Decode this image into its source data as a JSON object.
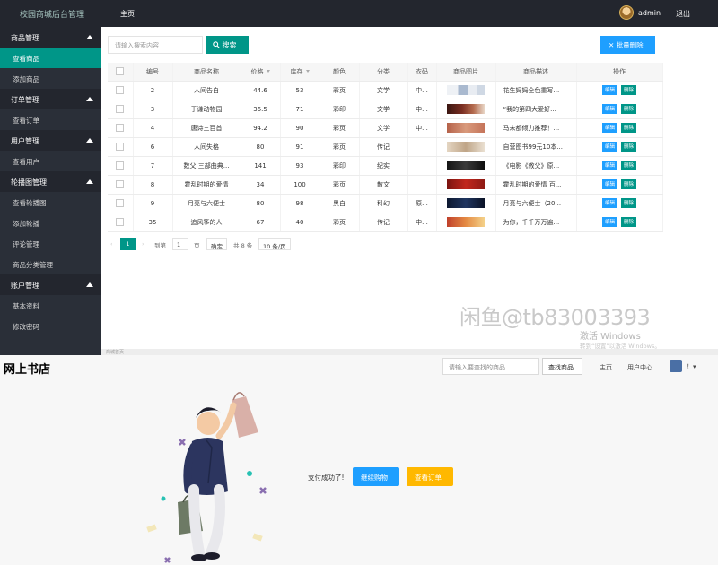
{
  "admin": {
    "brand": "校园商城后台管理",
    "top_home": "主页",
    "username": "admin",
    "logout": "退出",
    "sidebar": [
      {
        "type": "group",
        "label": "商品管理"
      },
      {
        "type": "item",
        "label": "查看商品",
        "active": true
      },
      {
        "type": "item",
        "label": "添加商品"
      },
      {
        "type": "group",
        "label": "订单管理"
      },
      {
        "type": "item",
        "label": "查看订单"
      },
      {
        "type": "group",
        "label": "用户管理"
      },
      {
        "type": "item",
        "label": "查看用户"
      },
      {
        "type": "group",
        "label": "轮播图管理"
      },
      {
        "type": "item",
        "label": "查看轮播图"
      },
      {
        "type": "item",
        "label": "添加轮播"
      },
      {
        "type": "item",
        "label": "评论管理"
      },
      {
        "type": "item",
        "label": "商品分类管理"
      },
      {
        "type": "group",
        "label": "账户管理"
      },
      {
        "type": "item",
        "label": "基本资料"
      },
      {
        "type": "item",
        "label": "修改密码"
      }
    ],
    "search": {
      "placeholder": "请输入搜索内容",
      "button": "搜索"
    },
    "batch_delete": "批量删除",
    "table": {
      "headers": [
        "编号",
        "商品名称",
        "价格",
        "库存",
        "颜色",
        "分类",
        "衣码",
        "商品图片",
        "商品描述",
        "操作"
      ],
      "rows": [
        {
          "id": "2",
          "name": "人间告白",
          "price": "44.6",
          "stock": "53",
          "color": "彩页",
          "category": "文学",
          "size": "中...",
          "desc": "花生妈妈全色重写..."
        },
        {
          "id": "3",
          "name": "于谦动物园",
          "price": "36.5",
          "stock": "71",
          "color": "彩印",
          "category": "文学",
          "size": "中...",
          "desc": "“我的第四大爱好..."
        },
        {
          "id": "4",
          "name": "唐诗三百首",
          "price": "94.2",
          "stock": "90",
          "color": "彩页",
          "category": "文学",
          "size": "中...",
          "desc": "马未都倾力推荐！..."
        },
        {
          "id": "6",
          "name": "人间失格",
          "price": "80",
          "stock": "91",
          "color": "彩页",
          "category": "传记",
          "size": "",
          "desc": "自营图书99元10本..."
        },
        {
          "id": "7",
          "name": "数父 三部曲典...",
          "price": "141",
          "stock": "93",
          "color": "彩印",
          "category": "纪实",
          "size": "",
          "desc": "《电影《教父》原..."
        },
        {
          "id": "8",
          "name": "霍乱时期的爱情",
          "price": "34",
          "stock": "100",
          "color": "彩页",
          "category": "散文",
          "size": "",
          "desc": "霍乱时期的爱情 百..."
        },
        {
          "id": "9",
          "name": "月亮与六便士",
          "price": "80",
          "stock": "98",
          "color": "黑白",
          "category": "科幻",
          "size": "原...",
          "desc": "月亮与六便士（20..."
        },
        {
          "id": "35",
          "name": "追风筝的人",
          "price": "67",
          "stock": "40",
          "color": "彩页",
          "category": "传记",
          "size": "中...",
          "desc": "为你，千千万万遍..."
        }
      ],
      "edit_label": "编辑",
      "delete_label": "删除"
    },
    "pager": {
      "current": "1",
      "goto_label": "到第",
      "page_input": "1",
      "page_unit": "页",
      "confirm": "确定",
      "total": "共 8 条",
      "per_page": "10 条/页"
    },
    "watermark": "闲鱼@tb83003393",
    "windows_activate": "激活 Windows",
    "windows_hint": "转到“设置”以激活 Windows。",
    "footer_note": "商城首页"
  },
  "shop": {
    "logo": "网上书店",
    "search_placeholder": "请输入要查找的商品",
    "search_button": "查找商品",
    "nav_home": "主页",
    "nav_user_center": "用户中心",
    "nav_more": "！▾",
    "pay_message": "支付成功了!",
    "btn_continue": "继续购物",
    "btn_orders": "查看订单"
  },
  "colors": {
    "accent": "#009688",
    "blue": "#1e9fff",
    "orange": "#ffb800",
    "dark": "#23262e"
  }
}
